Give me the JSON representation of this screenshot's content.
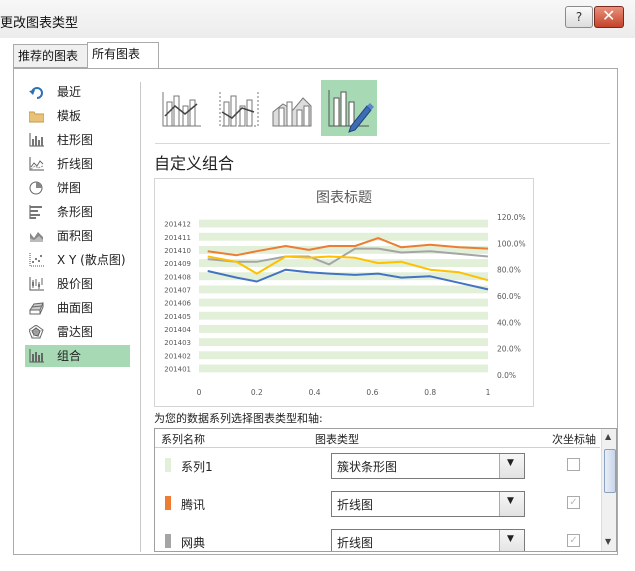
{
  "window": {
    "title": "更改图表类型",
    "help_label": "?"
  },
  "tabs": [
    {
      "label": "推荐的图表"
    },
    {
      "label": "所有图表"
    }
  ],
  "sidebar": {
    "items": [
      {
        "label": "最近",
        "icon": "recent-icon"
      },
      {
        "label": "模板",
        "icon": "folder-icon"
      },
      {
        "label": "柱形图",
        "icon": "column-chart-icon"
      },
      {
        "label": "折线图",
        "icon": "line-chart-icon"
      },
      {
        "label": "饼图",
        "icon": "pie-chart-icon"
      },
      {
        "label": "条形图",
        "icon": "bar-chart-icon"
      },
      {
        "label": "面积图",
        "icon": "area-chart-icon"
      },
      {
        "label": "X Y (散点图)",
        "icon": "scatter-chart-icon"
      },
      {
        "label": "股价图",
        "icon": "stock-chart-icon"
      },
      {
        "label": "曲面图",
        "icon": "surface-chart-icon"
      },
      {
        "label": "雷达图",
        "icon": "radar-chart-icon"
      },
      {
        "label": "组合",
        "icon": "combo-chart-icon",
        "selected": true
      }
    ]
  },
  "combo_types": [
    {
      "icon": "clustered-column-line-icon"
    },
    {
      "icon": "clustered-column-line-secondary-axis-icon"
    },
    {
      "icon": "stacked-area-clustered-column-icon"
    },
    {
      "icon": "custom-combination-icon",
      "selected": true
    }
  ],
  "section_heading": "自定义组合",
  "chart_data": {
    "type": "bar",
    "title": "图表标题",
    "orientation": "horizontal",
    "categories": [
      "201401",
      "201402",
      "201403",
      "201404",
      "201405",
      "201406",
      "201407",
      "201408",
      "201409",
      "201410",
      "201411",
      "201412"
    ],
    "x_ticks": [
      "0",
      "0.2",
      "0.4",
      "0.6",
      "0.8",
      "1"
    ],
    "xlim": [
      0,
      1
    ],
    "y2_ticks": [
      "0.0%",
      "20.0%",
      "40.0%",
      "60.0%",
      "80.0%",
      "100.0%",
      "120.0%"
    ],
    "y2lim": [
      0,
      120
    ],
    "bar_color": "#e2f0d9",
    "series": [
      {
        "kind": "bar",
        "color": "#e2f0d9",
        "values": [
          1,
          1,
          1,
          1,
          1,
          1,
          1,
          1,
          1,
          1,
          1,
          1
        ]
      },
      {
        "kind": "line",
        "color": "#ed7d31",
        "x": [
          0.03,
          0.13,
          0.2,
          0.3,
          0.38,
          0.45,
          0.54,
          0.62,
          0.7,
          0.8,
          0.9,
          1.0
        ],
        "values": [
          94,
          91,
          94,
          98,
          95,
          98,
          98,
          104,
          97,
          99,
          97,
          96
        ]
      },
      {
        "kind": "line",
        "color": "#a5a5a5",
        "x": [
          0.03,
          0.13,
          0.2,
          0.3,
          0.38,
          0.45,
          0.54,
          0.62,
          0.7,
          0.8,
          0.9,
          1.0
        ],
        "values": [
          88,
          86,
          86,
          90,
          90,
          84,
          96,
          96,
          93,
          94,
          92,
          90
        ]
      },
      {
        "kind": "line",
        "color": "#ffc000",
        "x": [
          0.03,
          0.13,
          0.2,
          0.3,
          0.38,
          0.45,
          0.54,
          0.62,
          0.7,
          0.8,
          0.9,
          1.0
        ],
        "values": [
          90,
          86,
          77,
          90,
          89,
          90,
          89,
          85,
          86,
          80,
          78,
          72
        ]
      },
      {
        "kind": "line",
        "color": "#4472c4",
        "x": [
          0.03,
          0.13,
          0.2,
          0.3,
          0.38,
          0.45,
          0.54,
          0.62,
          0.7,
          0.8,
          0.9,
          1.0
        ],
        "values": [
          79,
          74,
          71,
          80,
          78,
          77,
          76,
          77,
          74,
          75,
          70,
          65
        ]
      }
    ]
  },
  "series_prompt": "为您的数据系列选择图表类型和轴:",
  "grid": {
    "headers": {
      "name": "系列名称",
      "type": "图表类型",
      "secondary": "次坐标轴"
    },
    "rows": [
      {
        "name": "系列1",
        "color": "#e2f0d9",
        "chart_type": "簇状条形图",
        "secondary": false
      },
      {
        "name": "腾讯",
        "color": "#ed7d31",
        "chart_type": "折线图",
        "secondary": true
      },
      {
        "name": "网典",
        "color": "#a5a5a5",
        "chart_type": "折线图",
        "secondary": true
      }
    ]
  }
}
